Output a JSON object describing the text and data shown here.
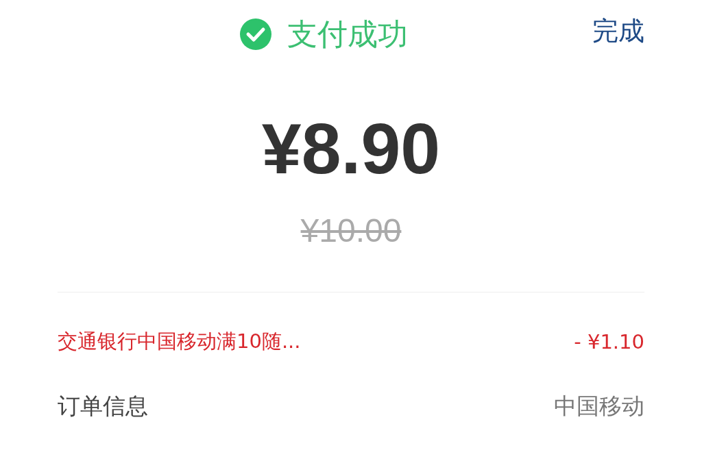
{
  "header": {
    "title": "支付成功",
    "done": "完成"
  },
  "amount": {
    "paid": "¥8.90",
    "original": "¥10.00"
  },
  "rows": [
    {
      "kind": "discount",
      "label": "交通银行中国移动满10随...",
      "value": "- ¥1.10"
    },
    {
      "kind": "info",
      "label": "订单信息",
      "value": "中国移动"
    }
  ]
}
